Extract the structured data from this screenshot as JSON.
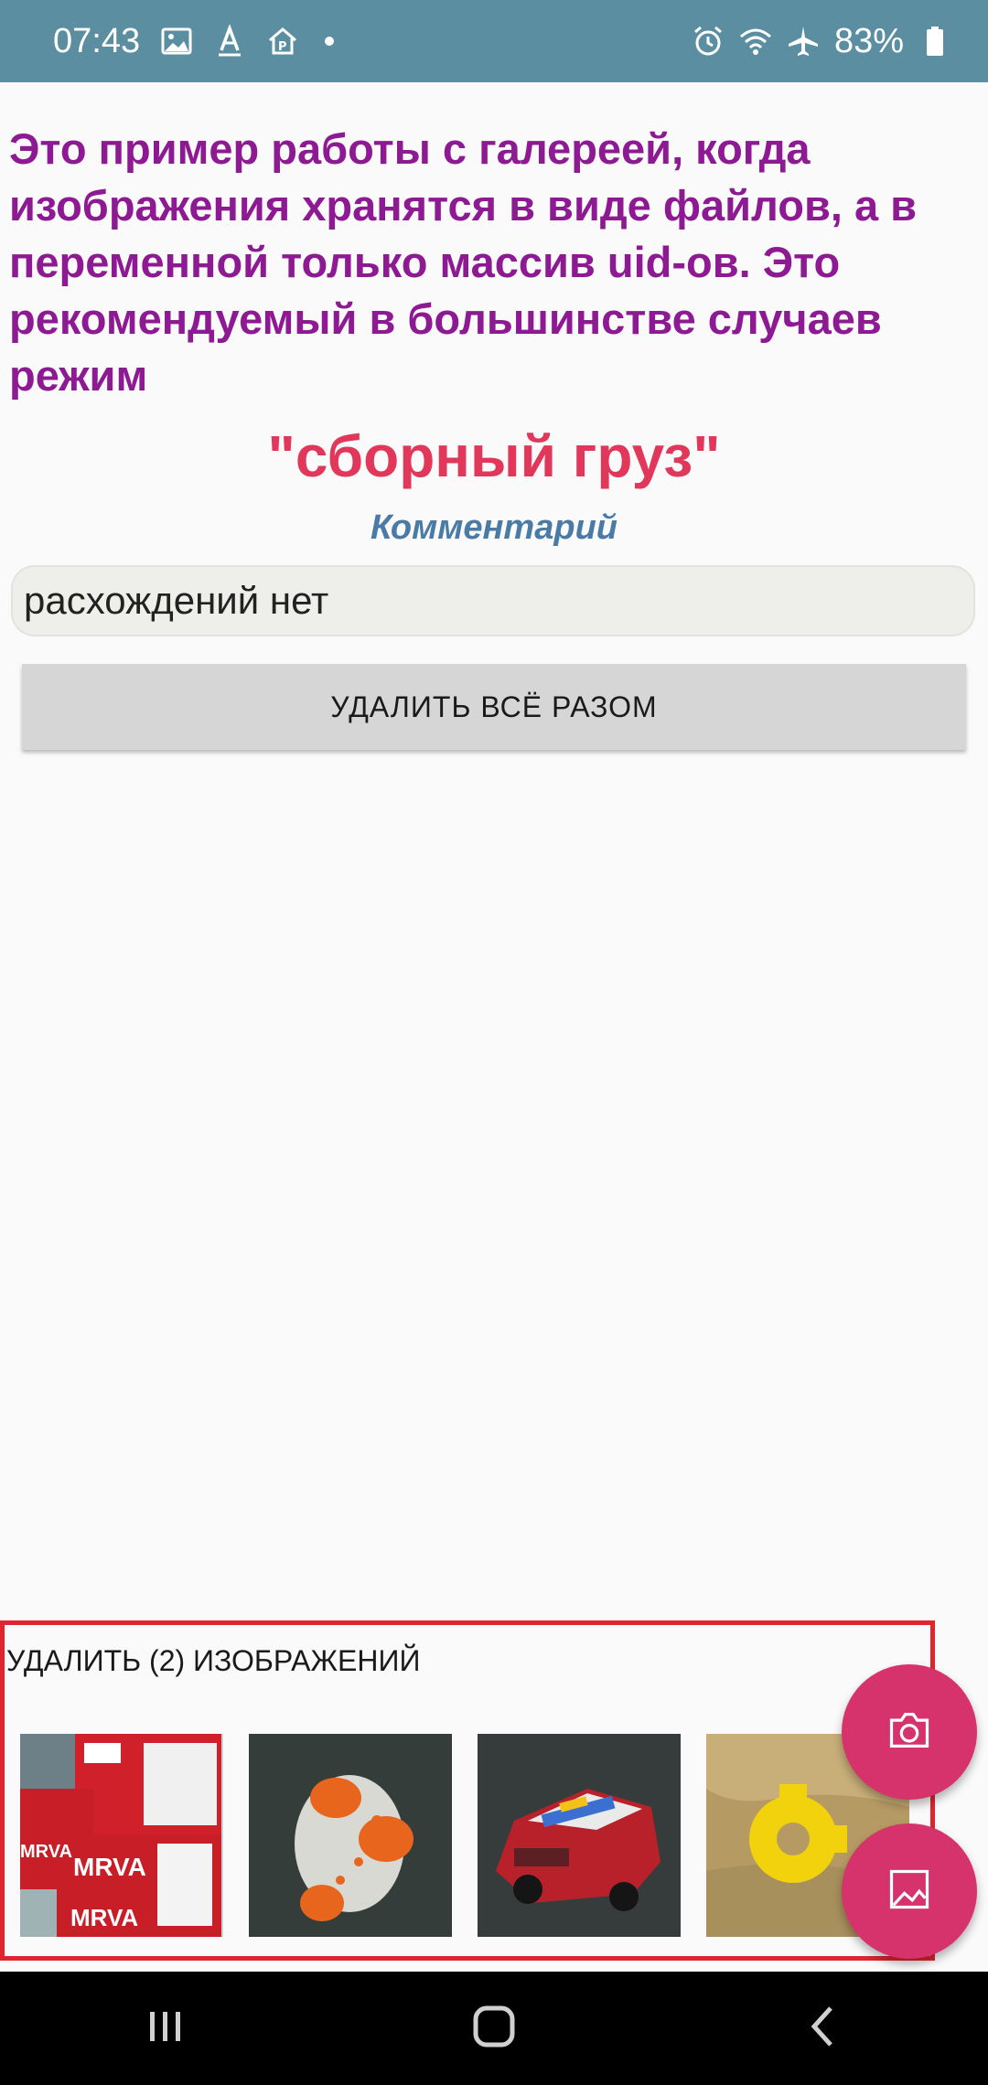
{
  "status_bar": {
    "time": "07:43",
    "battery": "83%",
    "left_icons": [
      "image-icon",
      "text-format-icon",
      "home-upload-icon",
      "dot-icon"
    ],
    "right_icons": [
      "alarm-icon",
      "wifi-icon",
      "airplane-icon",
      "battery-icon"
    ]
  },
  "main": {
    "headline": "Это пример работы с галереей, когда изображения хранятся в виде файлов, а в переменной только массив uid-ов. Это рекомендуемый в большинстве случаев режим",
    "cargo_title": "\"сборный груз\"",
    "comment_label": "Комментарий",
    "comment_value": "расхождений нет",
    "delete_all_label": "УДАЛИТЬ ВСЁ РАЗОМ"
  },
  "gallery": {
    "title": "УДАЛИТЬ (2) ИЗОБРАЖЕНИЙ",
    "thumbnails": [
      {
        "name": "thumbnail-mrva-boxes",
        "caption": "MRVA"
      },
      {
        "name": "thumbnail-toy-scooter",
        "caption": ""
      },
      {
        "name": "thumbnail-toy-car",
        "caption": ""
      },
      {
        "name": "thumbnail-yellow-part",
        "caption": ""
      }
    ]
  },
  "fabs": {
    "camera_icon": "camera-icon",
    "gallery_icon": "image-icon"
  },
  "colors": {
    "status_bar": "#5a8ea0",
    "headline": "#8e1a93",
    "cargo_title": "#e0375a",
    "comment_label": "#4a7ba6",
    "fab": "#d6336c",
    "highlight_border": "#e0252f"
  }
}
